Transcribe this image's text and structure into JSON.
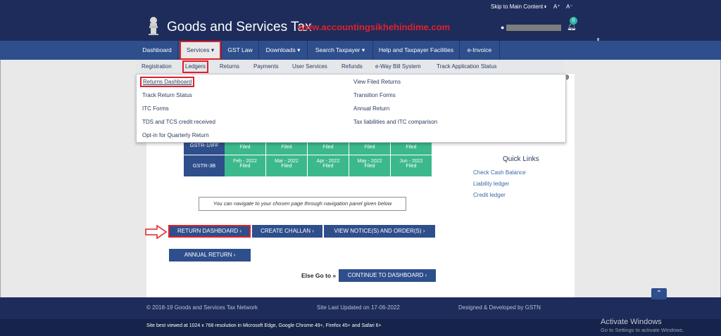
{
  "topbar": {
    "skip_link": "Skip to Main Content",
    "contrast_icon": "◑",
    "font_increase": "A⁺",
    "font_decrease": "A⁻"
  },
  "header": {
    "title": "Goods and Services Tax",
    "watermark": "www.accountingsikhehindime.com",
    "notification_count": "0"
  },
  "nav": {
    "dashboard": "Dashboard",
    "services": "Services ▾",
    "gst_law": "GST Law",
    "downloads": "Downloads ▾",
    "search_taxpayer": "Search Taxpayer ▾",
    "help": "Help and Taxpayer Facilities",
    "einvoice": "e-Invoice"
  },
  "subnav": {
    "registration": "Registration",
    "ledgers": "Ledgers",
    "returns": "Returns",
    "payments": "Payments",
    "user_services": "User Services",
    "refunds": "Refunds",
    "eway": "e-Way Bill System",
    "track_app": "Track Application Status"
  },
  "dropdown": {
    "returns_dashboard": "Returns Dashboard",
    "track_return_status": "Track Return Status",
    "itc_forms": "ITC Forms",
    "tds_tcs": "TDS and TCS credit received",
    "opt_in": "Opt-in for Quarterly Return",
    "view_filed": "View Filed Returns",
    "transition_forms": "Transition Forms",
    "annual_return": "Annual Return",
    "tax_liabilities": "Tax liabilities and ITC comparison"
  },
  "partial_text": "9",
  "returns_table": {
    "rows": [
      {
        "label": "GSTR-1/IFF",
        "cells": [
          "Filed",
          "Filed",
          "Filed",
          "Filed",
          "Filed"
        ]
      },
      {
        "label": "GSTR-3B",
        "cells": [
          {
            "period": "Feb - 2022",
            "status": "Filed"
          },
          {
            "period": "Mar - 2022",
            "status": "Filed"
          },
          {
            "period": "Apr - 2022",
            "status": "Filed"
          },
          {
            "period": "May - 2022",
            "status": "Filed"
          },
          {
            "period": "Jun - 2022",
            "status": "Filed"
          }
        ]
      }
    ]
  },
  "quick_links": {
    "title": "Quick Links",
    "items": [
      "Check Cash Balance",
      "Liability ledger",
      "Credit ledger"
    ]
  },
  "info_text": "You can navigate to your chosen page through navigation panel given below",
  "buttons": {
    "return_dashboard": "RETURN DASHBOARD ›",
    "create_challan": "CREATE CHALLAN ›",
    "view_notices": "VIEW NOTICE(S) AND ORDER(S) ›",
    "annual_return": "ANNUAL RETURN ›",
    "else_go_to": "Else Go to »",
    "continue_dashboard": "CONTINUE TO DASHBOARD ›"
  },
  "footer": {
    "copyright": "© 2018-19 Goods and Services Tax Network",
    "updated": "Site Last Updated on 17-06-2022",
    "designed": "Designed & Developed by GSTN",
    "best_viewed": "Site best viewed at 1024 x 768 resolution in Microsoft Edge, Google Chrome 49+, Firefox 45+ and Safari 6+"
  },
  "windows_notice": {
    "title": "Activate Windows",
    "subtitle": "Go to Settings to activate Windows."
  },
  "colors": {
    "header_bg": "#1d2c5b",
    "nav_bg": "#2e4e8c",
    "filed_green": "#3cb98c",
    "highlight_red": "#e0202a"
  }
}
